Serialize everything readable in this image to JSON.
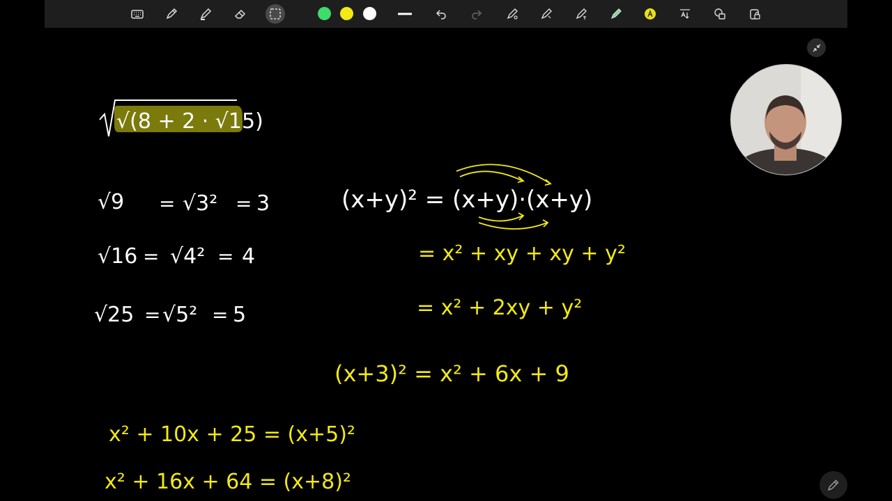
{
  "toolbar": {
    "tools": [
      "keyboard-icon",
      "pen-icon",
      "highlighter-icon",
      "eraser-icon",
      "lasso-select-icon"
    ],
    "colors": {
      "green": "#3ddc6b",
      "yellow": "#f2ea12",
      "white": "#ffffff"
    },
    "actions": [
      "stroke-width-icon",
      "undo-icon",
      "redo-icon",
      "shape-pen-icon",
      "ruler-pen-icon",
      "text-pen-icon",
      "auto-highlight-icon",
      "ai-write-icon",
      "text-size-icon",
      "shapes-icon",
      "lock-icon"
    ]
  },
  "board": {
    "main_expression": "√(8 + 2 · √15)",
    "white_lines": [
      {
        "lhs": "√9",
        "mid": "√3²",
        "rhs": "3"
      },
      {
        "lhs": "√16",
        "mid": "√4²",
        "rhs": "4"
      },
      {
        "lhs": "√25",
        "mid": "√5²",
        "rhs": "5"
      }
    ],
    "expansion": {
      "line1": "(x+y)² = (x+y)·(x+y)",
      "line2": "= x² + xy + xy + y²",
      "line3": "= x² + 2xy + y²"
    },
    "example1": "(x+3)² = x² + 6x + 9",
    "example2": "x² + 10x + 25 = (x+5)²",
    "example3": "x² + 16x + 64 = (x+8)²"
  },
  "colors": {
    "ink_white": "#ffffff",
    "ink_yellow": "#f2ea12",
    "highlight": "#7b7a0c",
    "toolbar_bg": "#1e1e1e"
  }
}
